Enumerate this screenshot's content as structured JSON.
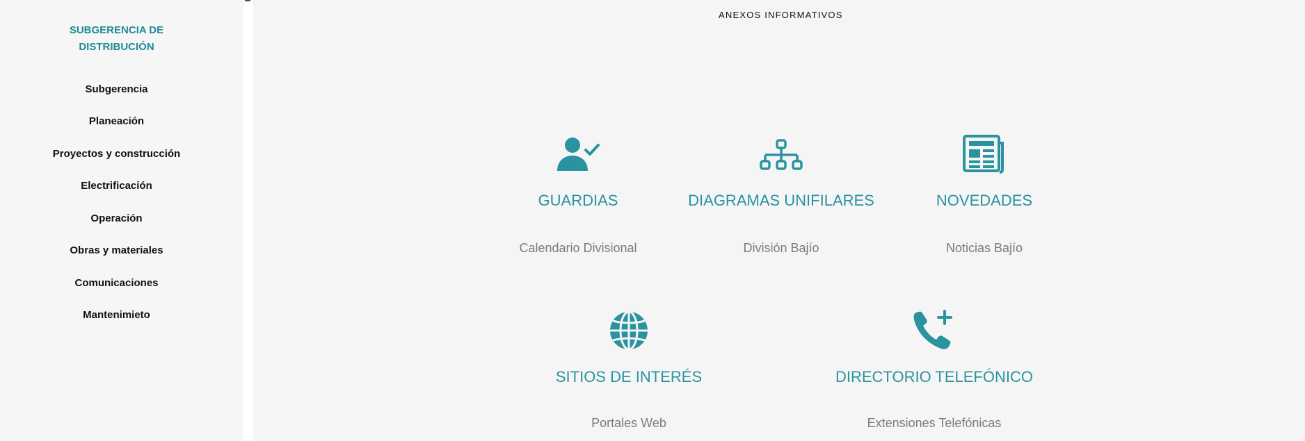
{
  "sidebar": {
    "title_line1": "SUBGERENCIA DE",
    "title_line2": "DISTRIBUCIÓN",
    "items": [
      {
        "label": "Subgerencia"
      },
      {
        "label": "Planeación"
      },
      {
        "label": "Proyectos y construcción"
      },
      {
        "label": "Electrificación"
      },
      {
        "label": "Operación"
      },
      {
        "label": "Obras y materiales"
      },
      {
        "label": "Comunicaciones"
      },
      {
        "label": "Mantenimieto"
      }
    ]
  },
  "main": {
    "title": "ANEXOS INFORMATIVOS",
    "cards": [
      {
        "title": "GUARDIAS",
        "subtitle": "Calendario Divisional",
        "icon": "user-check-icon"
      },
      {
        "title": "DIAGRAMAS UNIFILARES",
        "subtitle": "División Bajío",
        "icon": "sitemap-icon"
      },
      {
        "title": "NOVEDADES",
        "subtitle": "Noticias Bajío",
        "icon": "newspaper-icon"
      },
      {
        "title": "SITIOS DE INTERÉS",
        "subtitle": "Portales Web",
        "icon": "globe-icon"
      },
      {
        "title": "DIRECTORIO TELEFÓNICO",
        "subtitle": "Extensiones Telefónicas",
        "icon": "phone-add-icon"
      }
    ]
  },
  "colors": {
    "accent": "#2a93a0",
    "sidebar_title": "#1f8a96",
    "subtitle": "#7b7b7b",
    "background": "#f5f5f5"
  }
}
